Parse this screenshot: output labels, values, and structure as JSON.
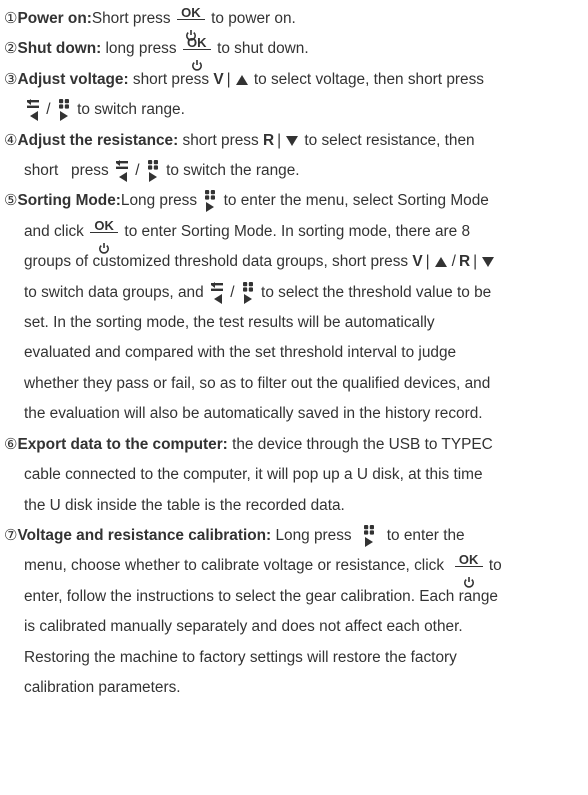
{
  "items": [
    {
      "num": "①",
      "title": "Power on:",
      "lines": [
        [
          "Short press ",
          "{OK}",
          " to power on."
        ]
      ]
    },
    {
      "num": "②",
      "title": "Shut down:",
      "lines": [
        [
          " long press ",
          "{OK}",
          " to shut down."
        ]
      ]
    },
    {
      "num": "③",
      "title": "Adjust voltage:",
      "lines": [
        [
          " short press ",
          "{V}",
          " to select voltage, then short press"
        ],
        [
          "{LEFT}",
          " / ",
          "{RIGHT}",
          " to switch range."
        ]
      ]
    },
    {
      "num": "④",
      "title": "Adjust the resistance:",
      "lines": [
        [
          " short press ",
          "{R}",
          " to select resistance, then"
        ],
        [
          "short   press ",
          "{LEFT}",
          " / ",
          "{RIGHT}",
          " to switch the range."
        ]
      ]
    },
    {
      "num": "⑤",
      "title": "Sorting Mode:",
      "lines": [
        [
          "Long press ",
          "{RIGHT}",
          " to enter the menu, select Sorting Mode"
        ],
        [
          "and click ",
          "{OK}",
          " to enter Sorting Mode. In sorting mode, there are 8"
        ],
        [
          "groups of customized threshold data groups, short press ",
          "{VR}",
          ""
        ],
        [
          "to switch data groups, and ",
          "{LEFT}",
          " / ",
          "{RIGHT}",
          " to select the threshold value to be"
        ],
        [
          "set. In the sorting mode, the test results will be automatically"
        ],
        [
          "evaluated and compared with the set threshold interval to judge"
        ],
        [
          "whether they pass or fail, so as to filter out the qualified devices, and"
        ],
        [
          "the evaluation will also be automatically saved in the history record."
        ]
      ]
    },
    {
      "num": "⑥",
      "title": "Export data to the computer:",
      "lines": [
        [
          " the device through the USB to TYPEC"
        ],
        [
          "cable connected to the computer, it will pop up a U disk, at this time"
        ],
        [
          "the U disk inside the table is the recorded data."
        ]
      ]
    },
    {
      "num": "⑦",
      "title": "Voltage and resistance calibration:",
      "lines": [
        [
          " Long press  ",
          "{RIGHT}",
          "  to enter the"
        ],
        [
          "menu, choose whether to calibrate voltage or resistance, click  ",
          "{OK}",
          " to"
        ],
        [
          "enter, follow the instructions to select the gear calibration. Each range"
        ],
        [
          "is calibrated manually separately and does not affect each other."
        ],
        [
          "Restoring the machine to factory settings will restore the factory"
        ],
        [
          "calibration parameters."
        ]
      ]
    }
  ],
  "symbols": {
    "ok_label": "OK",
    "v_label": "V",
    "r_label": "R",
    "separator": "|",
    "slash": "/"
  }
}
